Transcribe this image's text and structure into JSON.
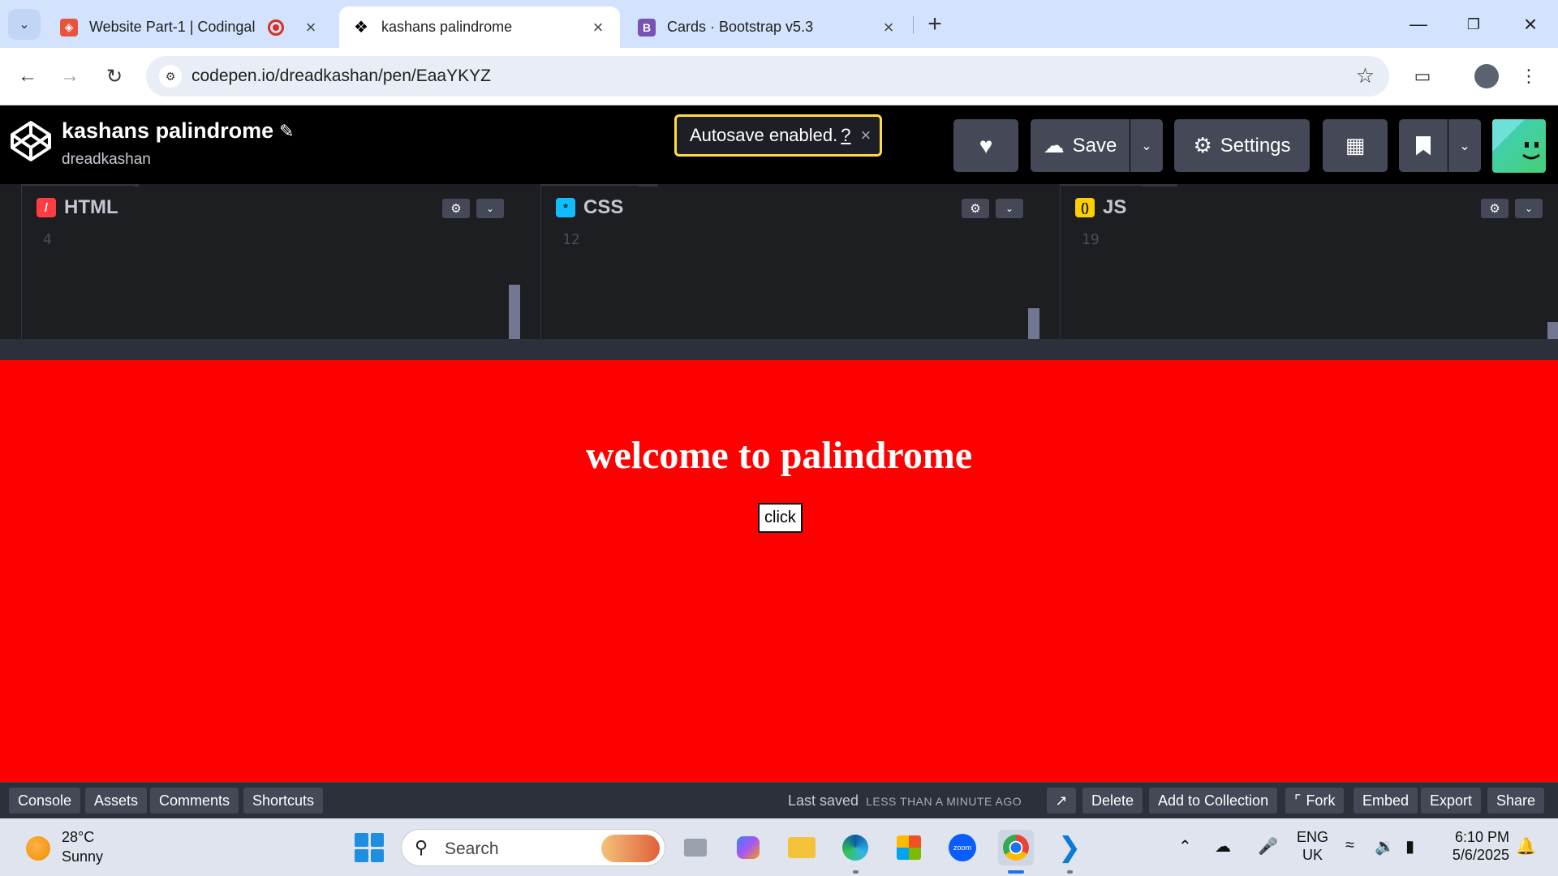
{
  "browser": {
    "tabs": [
      {
        "title": "Website Part-1 | Codingal",
        "active": false
      },
      {
        "title": "kashans palindrome",
        "active": true
      },
      {
        "title": "Cards · Bootstrap v5.3",
        "active": false
      }
    ],
    "url": "codepen.io/dreadkashan/pen/EaaYKYZ"
  },
  "codepen": {
    "title": "kashans palindrome",
    "user": "dreadkashan",
    "autosave_text": "Autosave enabled.",
    "autosave_help": "?",
    "save_label": "Save",
    "settings_label": "Settings"
  },
  "editors": [
    {
      "lang": "HTML",
      "line": "4",
      "color": "#ff3c41"
    },
    {
      "lang": "CSS",
      "line": "12",
      "color": "#0ebeff"
    },
    {
      "lang": "JS",
      "line": "19",
      "color": "#fcd000"
    }
  ],
  "preview": {
    "heading": "welcome to palindrome",
    "button_label": "click",
    "background": "#ff0000"
  },
  "footer": {
    "left_buttons": [
      "Console",
      "Assets",
      "Comments",
      "Shortcuts"
    ],
    "last_saved_label": "Last saved",
    "last_saved_time": "LESS THAN A MINUTE AGO",
    "right_buttons": [
      "Delete",
      "Add to Collection",
      "Fork",
      "Embed",
      "Export",
      "Share"
    ]
  },
  "taskbar": {
    "temperature": "28°C",
    "condition": "Sunny",
    "search_label": "Search",
    "lang_line1": "ENG",
    "lang_line2": "UK",
    "time": "6:10 PM",
    "date": "5/6/2025"
  }
}
